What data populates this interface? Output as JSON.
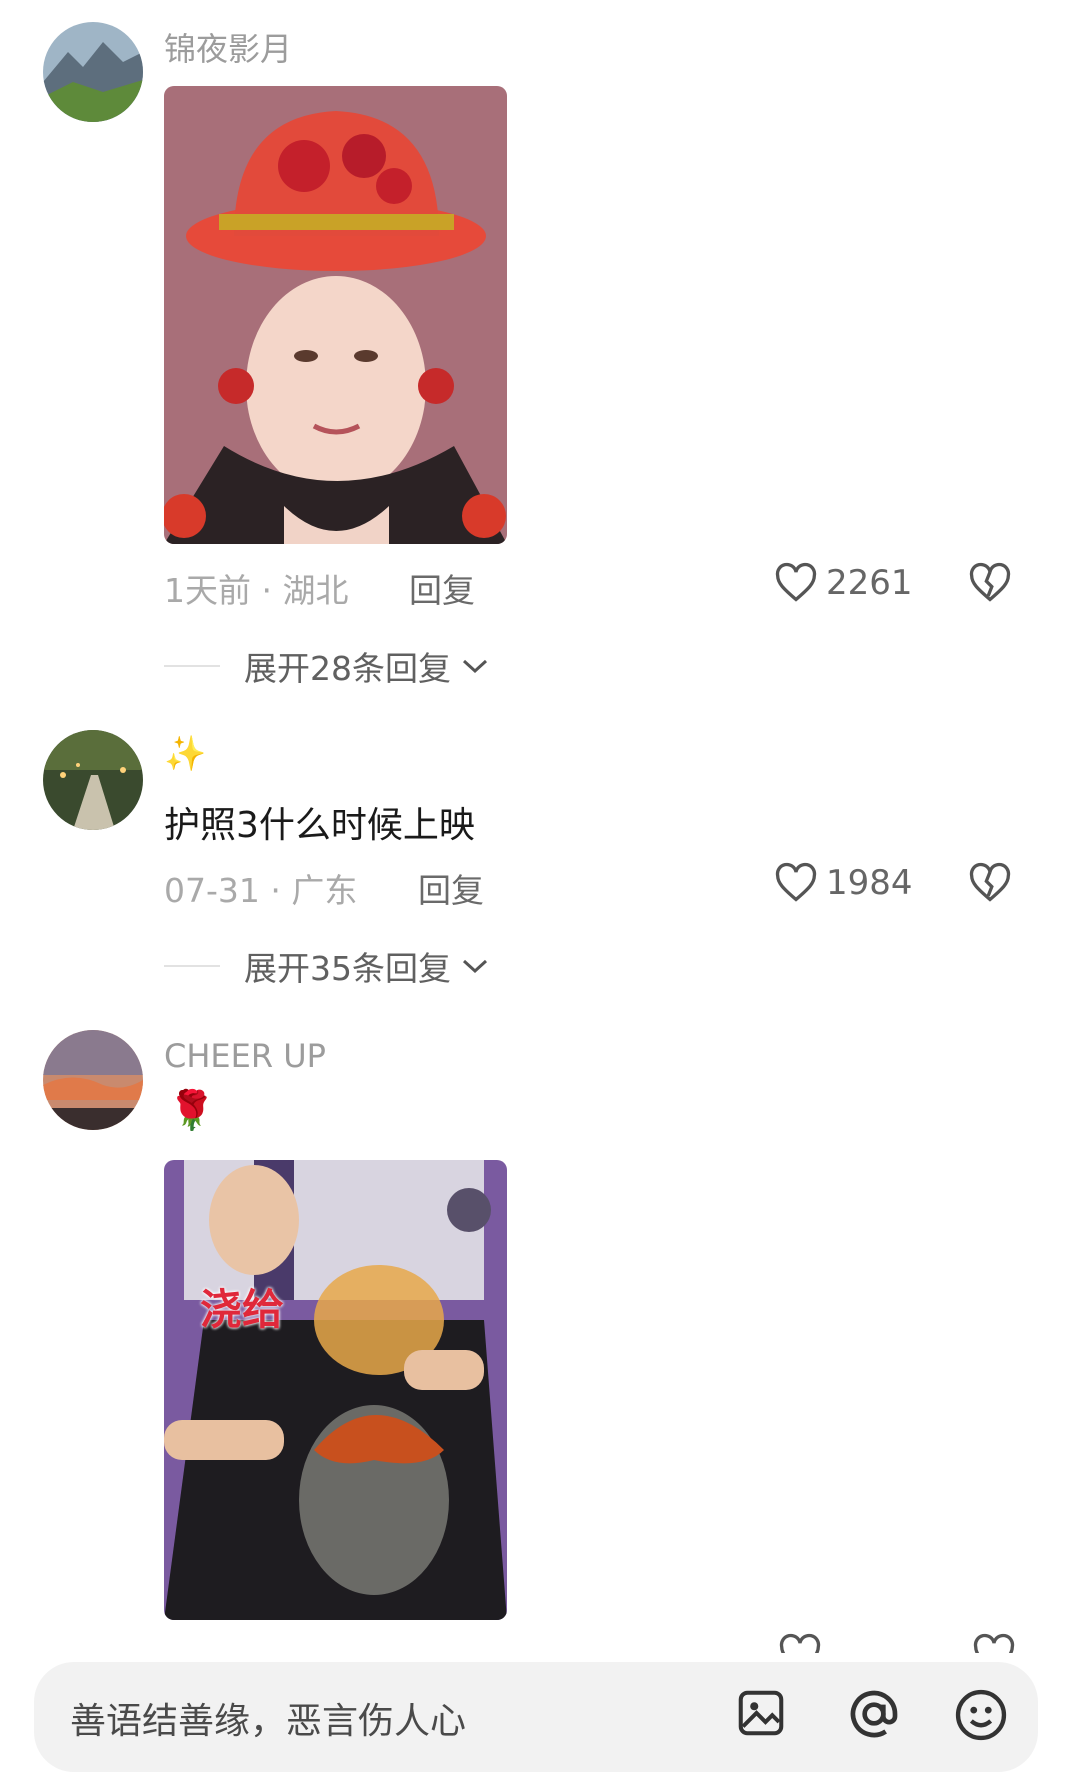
{
  "comments": [
    {
      "username": "锦夜影月",
      "time": "1天前",
      "location": "湖北",
      "reply_label": "回复",
      "likes": "2261",
      "expand_label": "展开28条回复",
      "media": "image-red-hat-portrait"
    },
    {
      "username": "✨",
      "text": "护照3什么时候上映",
      "time": "07-31",
      "location": "广东",
      "reply_label": "回复",
      "likes": "1984",
      "expand_label": "展开35条回复"
    },
    {
      "username": "CHEER UP",
      "text": "🌹",
      "media": "image-pouring-sauce",
      "media_caption": "浇给"
    }
  ],
  "input": {
    "placeholder": "善语结善缘，恶言伤人心"
  },
  "icons": [
    "heart-icon",
    "broken-heart-icon",
    "chevron-down-icon",
    "image-icon",
    "at-icon",
    "emoji-icon"
  ],
  "colors": {
    "muted": "#9c9c9c",
    "bar": "#f2f2f2"
  }
}
